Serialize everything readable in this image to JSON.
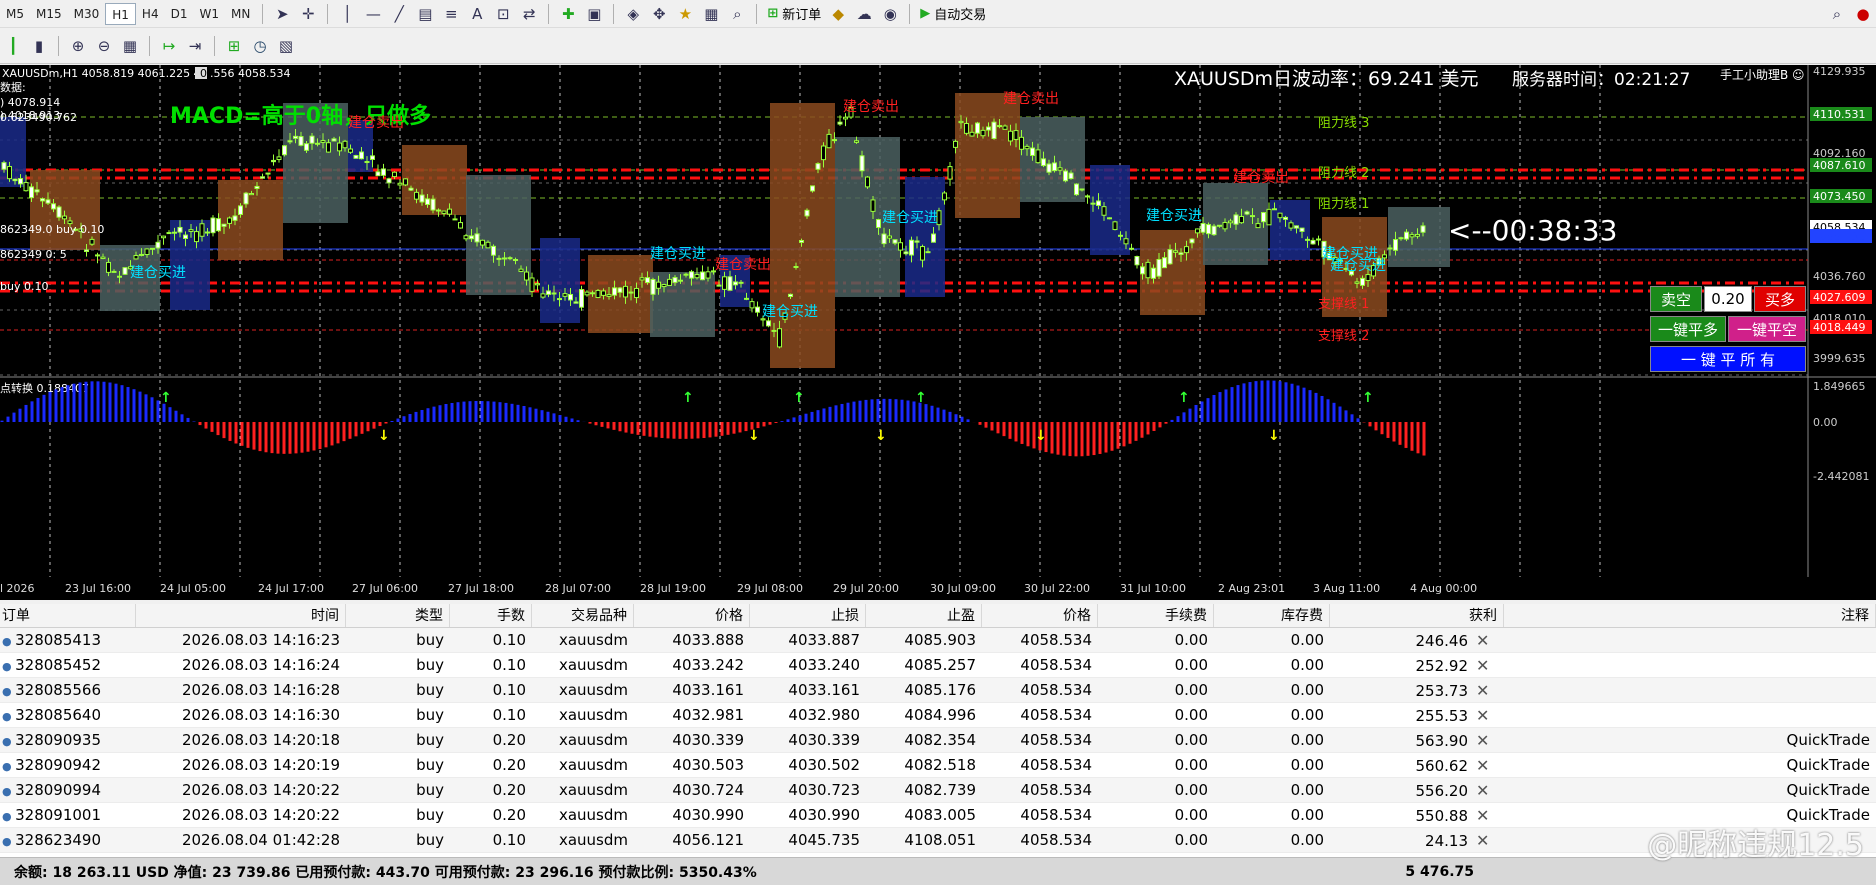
{
  "toolbar1": {
    "timeframes": [
      "M5",
      "M15",
      "M30",
      "H1",
      "H4",
      "D1",
      "W1",
      "MN"
    ],
    "active_timeframe": "H1",
    "new_order_label": "新订单",
    "auto_trade_label": "自动交易"
  },
  "chart": {
    "symbol_header": "XAUUSDm,H1  4058.819 4061.225 4",
    "symbol_header_tail": ".556 4058.534",
    "volatility_text": "XAUUSDm日波动率：69.241 美元",
    "server_time_text": "服务器时间：02:21:27",
    "ea_name": "手工小助理B ☺",
    "macd_text": "MACD=高于0轴，只做多",
    "countdown": "<--00:38:33",
    "left_labels": [
      "数据:",
      ") 4078.914",
      ") 4018.913",
      "0.623490.762",
      "862349.0 buy 0.10",
      "862349 0: 5",
      "buy 0.10"
    ],
    "resistance_labels": [
      "阻力线 3",
      "阻力线 2",
      "阻力线 1"
    ],
    "support_labels": [
      "支撑线 1",
      "支撑线 2"
    ],
    "signal_labels": [
      "建仓卖出",
      "建仓卖出",
      "建仓卖出",
      "建仓卖出",
      "建仓卖出",
      "建仓买进",
      "建仓买进",
      "建仓买进",
      "建仓买进",
      "建仓买进",
      "建仓买进",
      "建仓买进"
    ],
    "price_axis": [
      "4129.935",
      "4110.531",
      "4092.160",
      "4087.610",
      "4073.450",
      "4058.534",
      "4055.135",
      "4036.760",
      "4027.609",
      "4018.010",
      "4018.449",
      "3999.635"
    ],
    "osc_label": "点转换 0.188407",
    "osc_axis": [
      "1.849665",
      "0.00",
      "-2.442081"
    ],
    "date_axis": [
      "l 2026",
      "23 Jul 16:00",
      "24 Jul 05:00",
      "24 Jul 17:00",
      "27 Jul 06:00",
      "27 Jul 18:00",
      "28 Jul 07:00",
      "28 Jul 19:00",
      "29 Jul 08:00",
      "29 Jul 20:00",
      "30 Jul 09:00",
      "30 Jul 22:00",
      "31 Jul 10:00",
      "2 Aug 23:01",
      "3 Aug 11:00",
      "4 Aug 00:00"
    ],
    "panel": {
      "sell_label": "卖空",
      "lot_value": "0.20",
      "buy_label": "买多",
      "close_buy_label": "一键平多",
      "close_sell_label": "一键平空",
      "close_all_label": "一 键 平 所 有"
    }
  },
  "table": {
    "headers": [
      "订单",
      "时间",
      "类型",
      "手数",
      "交易品种",
      "价格",
      "止损",
      "止盈",
      "价格",
      "手续费",
      "库存费",
      "获利",
      "注释"
    ],
    "rows": [
      [
        "328085413",
        "2026.08.03 14:16:23",
        "buy",
        "0.10",
        "xauusdm",
        "4033.888",
        "4033.887",
        "4085.903",
        "4058.534",
        "0.00",
        "0.00",
        "246.46",
        ""
      ],
      [
        "328085452",
        "2026.08.03 14:16:24",
        "buy",
        "0.10",
        "xauusdm",
        "4033.242",
        "4033.240",
        "4085.257",
        "4058.534",
        "0.00",
        "0.00",
        "252.92",
        ""
      ],
      [
        "328085566",
        "2026.08.03 14:16:28",
        "buy",
        "0.10",
        "xauusdm",
        "4033.161",
        "4033.161",
        "4085.176",
        "4058.534",
        "0.00",
        "0.00",
        "253.73",
        ""
      ],
      [
        "328085640",
        "2026.08.03 14:16:30",
        "buy",
        "0.10",
        "xauusdm",
        "4032.981",
        "4032.980",
        "4084.996",
        "4058.534",
        "0.00",
        "0.00",
        "255.53",
        ""
      ],
      [
        "328090935",
        "2026.08.03 14:20:18",
        "buy",
        "0.20",
        "xauusdm",
        "4030.339",
        "4030.339",
        "4082.354",
        "4058.534",
        "0.00",
        "0.00",
        "563.90",
        "QuickTrade"
      ],
      [
        "328090942",
        "2026.08.03 14:20:19",
        "buy",
        "0.20",
        "xauusdm",
        "4030.503",
        "4030.502",
        "4082.518",
        "4058.534",
        "0.00",
        "0.00",
        "560.62",
        "QuickTrade"
      ],
      [
        "328090994",
        "2026.08.03 14:20:22",
        "buy",
        "0.20",
        "xauusdm",
        "4030.724",
        "4030.723",
        "4082.739",
        "4058.534",
        "0.00",
        "0.00",
        "556.20",
        "QuickTrade"
      ],
      [
        "328091001",
        "2026.08.03 14:20:22",
        "buy",
        "0.20",
        "xauusdm",
        "4030.990",
        "4030.990",
        "4083.005",
        "4058.534",
        "0.00",
        "0.00",
        "550.88",
        "QuickTrade"
      ],
      [
        "328623490",
        "2026.08.04 01:42:28",
        "buy",
        "0.10",
        "xauusdm",
        "4056.121",
        "4045.735",
        "4108.051",
        "4058.534",
        "0.00",
        "0.00",
        "24.13",
        ""
      ]
    ],
    "status": "余额: 18 263.11 USD  净值: 23 739.86  已用预付款: 443.70  可用预付款: 23 296.16  预付款比例: 5350.43%",
    "total_profit": "5 476.75"
  },
  "watermark": "@昵称违规12.5"
}
